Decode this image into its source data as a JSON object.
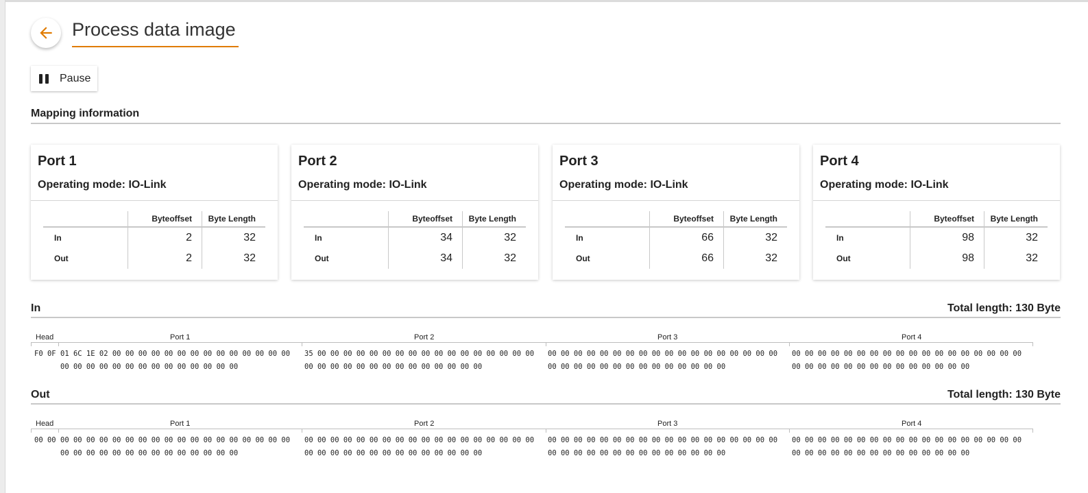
{
  "page": {
    "title": "Process data image",
    "accent": "#e07b00"
  },
  "toolbar": {
    "pause_label": "Pause",
    "back_icon": "arrow-left-icon",
    "pause_icon": "pause-icon"
  },
  "mapping": {
    "heading": "Mapping information",
    "col_byteoffset": "Byteoffset",
    "col_bytelength": "Byte Length",
    "ports": [
      {
        "name": "Port 1",
        "mode": "Operating mode: IO-Link",
        "rows": [
          {
            "label": "In",
            "offset": "2",
            "length": "32"
          },
          {
            "label": "Out",
            "offset": "2",
            "length": "32"
          }
        ]
      },
      {
        "name": "Port 2",
        "mode": "Operating mode: IO-Link",
        "rows": [
          {
            "label": "In",
            "offset": "34",
            "length": "32"
          },
          {
            "label": "Out",
            "offset": "34",
            "length": "32"
          }
        ]
      },
      {
        "name": "Port 3",
        "mode": "Operating mode: IO-Link",
        "rows": [
          {
            "label": "In",
            "offset": "66",
            "length": "32"
          },
          {
            "label": "Out",
            "offset": "66",
            "length": "32"
          }
        ]
      },
      {
        "name": "Port 4",
        "mode": "Operating mode: IO-Link",
        "rows": [
          {
            "label": "In",
            "offset": "98",
            "length": "32"
          },
          {
            "label": "Out",
            "offset": "98",
            "length": "32"
          }
        ]
      }
    ]
  },
  "in_section": {
    "heading": "In",
    "total": "Total length: 130 Byte",
    "head_label": "Head",
    "port_labels": [
      "Port 1",
      "Port 2",
      "Port 3",
      "Port 4"
    ],
    "head_bytes": "F0 0F",
    "port1_line1": "01 6C 1E 02 00 00 00 00 00 00 00 00 00 00 00 00 00 00",
    "port1_line2": "00 00 00 00 00 00 00 00 00 00 00 00 00 00",
    "port2_line1": "35 00 00 00 00 00 00 00 00 00 00 00 00 00 00 00 00 00",
    "port2_line2": "00 00 00 00 00 00 00 00 00 00 00 00 00 00",
    "port3_line1": "00 00 00 00 00 00 00 00 00 00 00 00 00 00 00 00 00 00",
    "port3_line2": "00 00 00 00 00 00 00 00 00 00 00 00 00 00",
    "port4_line1": "00 00 00 00 00 00 00 00 00 00 00 00 00 00 00 00 00 00",
    "port4_line2": "00 00 00 00 00 00 00 00 00 00 00 00 00 00"
  },
  "out_section": {
    "heading": "Out",
    "total": "Total length: 130 Byte",
    "head_label": "Head",
    "port_labels": [
      "Port 1",
      "Port 2",
      "Port 3",
      "Port 4"
    ],
    "head_bytes": "00 00",
    "port1_line1": "00 00 00 00 00 00 00 00 00 00 00 00 00 00 00 00 00 00",
    "port1_line2": "00 00 00 00 00 00 00 00 00 00 00 00 00 00",
    "port2_line1": "00 00 00 00 00 00 00 00 00 00 00 00 00 00 00 00 00 00",
    "port2_line2": "00 00 00 00 00 00 00 00 00 00 00 00 00 00",
    "port3_line1": "00 00 00 00 00 00 00 00 00 00 00 00 00 00 00 00 00 00",
    "port3_line2": "00 00 00 00 00 00 00 00 00 00 00 00 00 00",
    "port4_line1": "00 00 00 00 00 00 00 00 00 00 00 00 00 00 00 00 00 00",
    "port4_line2": "00 00 00 00 00 00 00 00 00 00 00 00 00 00"
  }
}
